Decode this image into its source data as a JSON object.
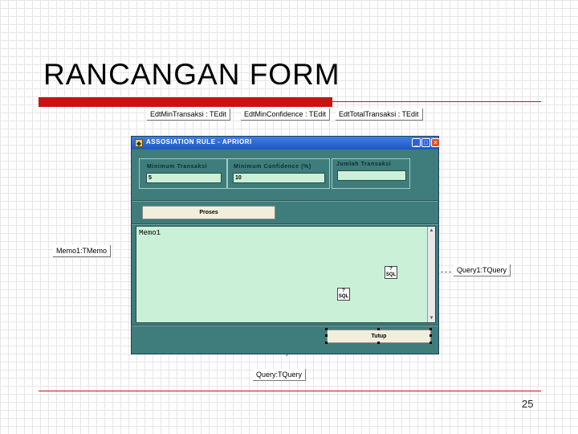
{
  "slide": {
    "title": "RANCANGAN FORM",
    "page_number": "25",
    "accent_color": "#cc1111"
  },
  "callouts": {
    "edt_min": "EdtMinTransaksi : TEdit",
    "edt_conf": "EdtMinConfidence : TEdit",
    "edt_total": "EdtTotalTransaksi : TEdit",
    "memo": "Memo1:TMemo",
    "query1": "Query1:TQuery",
    "query": "Query:TQuery"
  },
  "dialog": {
    "title": "ASSOSIATION RULE - APRIORI",
    "titlebar_color": "#1e56c8",
    "body_color": "#3e7d7b",
    "icons": {
      "app": "app-icon",
      "minimize": "minimize-icon",
      "maximize": "maximize-icon",
      "close": "close-icon"
    },
    "min_transaksi": {
      "label": "Minimum Transaksi",
      "value": "5"
    },
    "min_confidence": {
      "label": "Minimum Confidence (%)",
      "value": "10"
    },
    "jumlah_transaksi": {
      "label": "Jumlah Transaksi",
      "value": ""
    },
    "proses_label": "Proses",
    "memo_text": "Memo1",
    "sql_icon_text": "SQL",
    "tutup_label": "Tutup"
  }
}
